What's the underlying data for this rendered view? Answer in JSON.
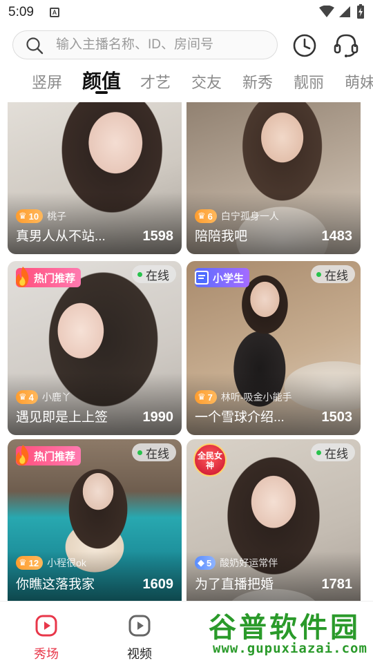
{
  "status_bar": {
    "time": "5:09"
  },
  "search": {
    "placeholder": "输入主播名称、ID、房间号"
  },
  "tabs": [
    {
      "label": "竖屏"
    },
    {
      "label": "颜值",
      "active": true
    },
    {
      "label": "才艺"
    },
    {
      "label": "交友"
    },
    {
      "label": "新秀"
    },
    {
      "label": "靓丽"
    },
    {
      "label": "萌妹"
    }
  ],
  "cards": [
    {
      "title": "真男人从不站...",
      "count": "1598",
      "level": "10",
      "host": "桃子",
      "online": "",
      "badge": ""
    },
    {
      "title": "陪陪我吧",
      "count": "1483",
      "level": "6",
      "host": "白宁孤身一人",
      "online": "",
      "badge": ""
    },
    {
      "title": "遇见即是上上签",
      "count": "1990",
      "level": "4",
      "host": "小鹿丫",
      "online": "在线",
      "badge": "热门推荐"
    },
    {
      "title": "一个雪球介绍...",
      "count": "1503",
      "level": "7",
      "host": "林听-吸金小能手",
      "online": "在线",
      "badge": "小学生"
    },
    {
      "title": "你瞧这落我家",
      "count": "1609",
      "level": "12",
      "host": "小程很ok",
      "online": "在线",
      "badge": "热门推荐"
    },
    {
      "title": "为了直播把婚",
      "count": "1781",
      "level": "5",
      "host": "酸奶好运常伴",
      "online": "在线",
      "badge": "全民女神"
    }
  ],
  "bottom_nav": [
    {
      "label": "秀场",
      "active": true
    },
    {
      "label": "视频"
    },
    {
      "label": ""
    },
    {
      "label": ""
    },
    {
      "label": ""
    }
  ],
  "watermark": {
    "title": "谷普软件园",
    "url": "www.gupuxiazai.com"
  },
  "colors": {
    "accent": "#e8374a",
    "online_dot": "#27c24c",
    "level_badge": "#ff9d2e",
    "hot_badge": "#ff4f7b"
  }
}
